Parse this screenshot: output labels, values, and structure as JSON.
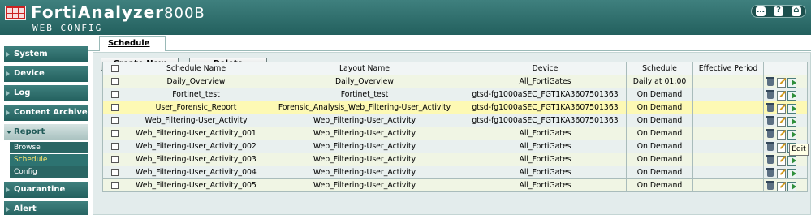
{
  "header": {
    "product_name": "FortiAnalyzer",
    "product_model": "800B",
    "subtitle": "WEB CONFIG",
    "icons": [
      "chat-icon",
      "help-icon",
      "logout-icon"
    ],
    "icon_glyphs": {
      "chat": "…",
      "help": "?",
      "logout": "⌂"
    }
  },
  "sidebar": {
    "items": [
      {
        "label": "System"
      },
      {
        "label": "Device"
      },
      {
        "label": "Log"
      },
      {
        "label": "Content Archive"
      },
      {
        "label": "Report"
      },
      {
        "label": "Quarantine"
      },
      {
        "label": "Alert"
      }
    ],
    "report_submenu": [
      {
        "label": "Browse"
      },
      {
        "label": "Schedule"
      },
      {
        "label": "Config"
      }
    ]
  },
  "main": {
    "tab_label": "Schedule",
    "buttons": {
      "create": "Create New",
      "delete": "Delete"
    },
    "table": {
      "columns": [
        "Schedule Name",
        "Layout Name",
        "Device",
        "Schedule",
        "Effective Period"
      ],
      "rows": [
        {
          "name": "Daily_Overview",
          "layout": "Daily_Overview",
          "device": "All_FortiGates",
          "schedule": "Daily at 01:00",
          "period": ""
        },
        {
          "name": "Fortinet_test",
          "layout": "Fortinet_test",
          "device": "gtsd-fg1000aSEC_FGT1KA3607501363",
          "schedule": "On Demand",
          "period": ""
        },
        {
          "name": "User_Forensic_Report",
          "layout": "Forensic_Analysis_Web_Filtering-User_Activity",
          "device": "gtsd-fg1000aSEC_FGT1KA3607501363",
          "schedule": "On Demand",
          "period": ""
        },
        {
          "name": "Web_Filtering-User_Activity",
          "layout": "Web_Filtering-User_Activity",
          "device": "gtsd-fg1000aSEC_FGT1KA3607501363",
          "schedule": "On Demand",
          "period": ""
        },
        {
          "name": "Web_Filtering-User_Activity_001",
          "layout": "Web_Filtering-User_Activity",
          "device": "All_FortiGates",
          "schedule": "On Demand",
          "period": ""
        },
        {
          "name": "Web_Filtering-User_Activity_002",
          "layout": "Web_Filtering-User_Activity",
          "device": "All_FortiGates",
          "schedule": "On Demand",
          "period": ""
        },
        {
          "name": "Web_Filtering-User_Activity_003",
          "layout": "Web_Filtering-User_Activity",
          "device": "All_FortiGates",
          "schedule": "On Demand",
          "period": ""
        },
        {
          "name": "Web_Filtering-User_Activity_004",
          "layout": "Web_Filtering-User_Activity",
          "device": "All_FortiGates",
          "schedule": "On Demand",
          "period": ""
        },
        {
          "name": "Web_Filtering-User_Activity_005",
          "layout": "Web_Filtering-User_Activity",
          "device": "All_FortiGates",
          "schedule": "On Demand",
          "period": ""
        }
      ]
    },
    "tooltip": "Edit"
  },
  "colors": {
    "header_teal": "#2c6e6c",
    "highlight_row": "#fdf9b4",
    "active_submenu_text": "#ffe66b"
  }
}
